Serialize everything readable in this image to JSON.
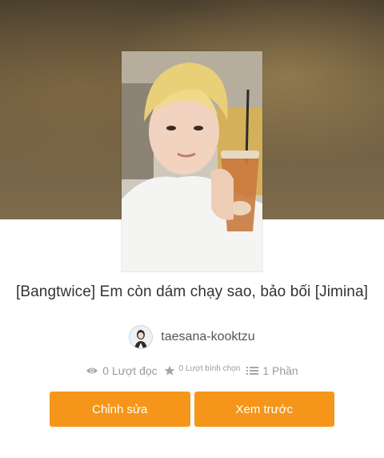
{
  "story": {
    "title": "[Bangtwice] Em còn dám chạy sao, bảo bối [Jimina]",
    "cover_icon": "story-cover-photo"
  },
  "author": {
    "name": "taesana-kooktzu",
    "avatar_icon": "author-avatar"
  },
  "stats": {
    "reads_label": "0 Lượt đọc",
    "reads_icon": "eye-icon",
    "votes_label": "0 Lượt bình chọn",
    "votes_icon": "star-icon",
    "parts_label": "1 Phần",
    "parts_icon": "list-icon"
  },
  "actions": {
    "edit_label": "Chỉnh sửa",
    "preview_label": "Xem trước"
  },
  "colors": {
    "accent": "#f5961a",
    "title_text": "#333333",
    "stats_text": "#9a9a9a"
  }
}
